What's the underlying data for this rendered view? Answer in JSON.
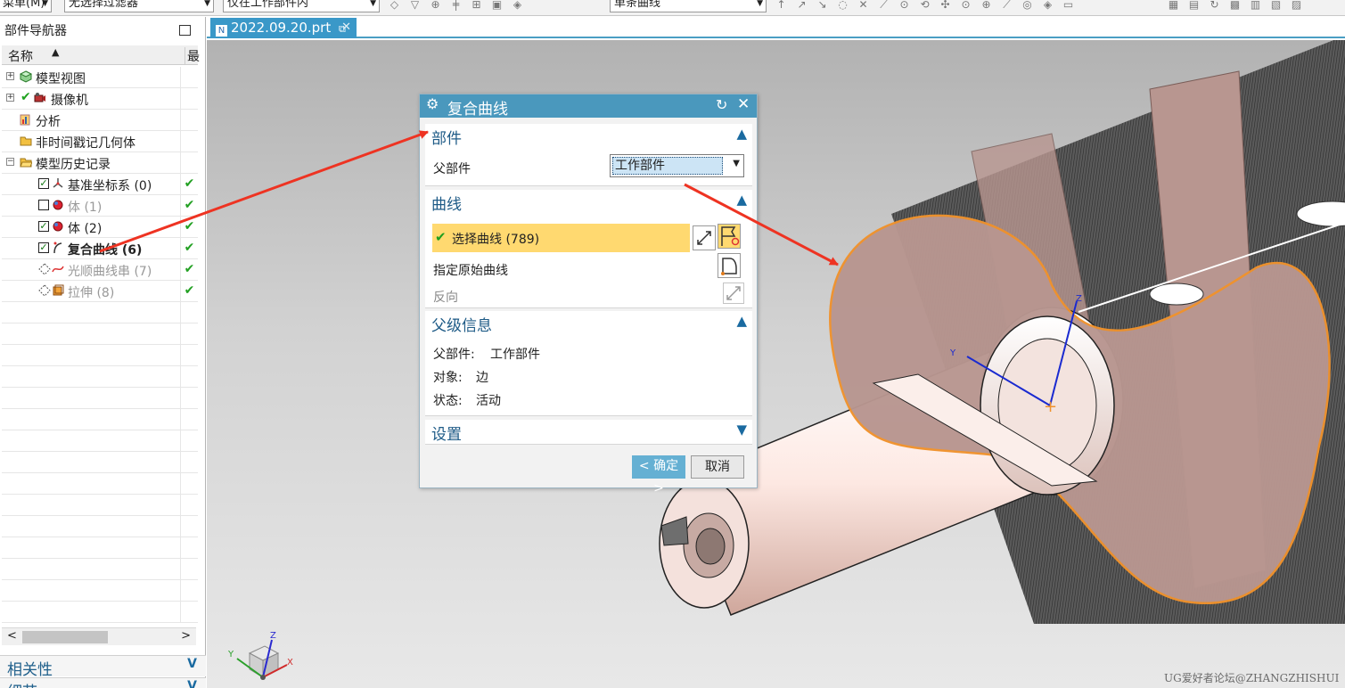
{
  "toolbar": {
    "menu_label": "菜单(M)",
    "filter_label": "无选择过滤器",
    "scope_label": "仅在工作部件内",
    "curve_rule_label": "单条曲线"
  },
  "navigator": {
    "title": "部件导航器",
    "col_name": "名称",
    "col_latest": "最",
    "items": [
      {
        "label": "模型视图",
        "icon": "model-views-icon"
      },
      {
        "label": "摄像机",
        "icon": "camera-icon"
      },
      {
        "label": "分析",
        "icon": "analysis-icon"
      },
      {
        "label": "非时间戳记几何体",
        "icon": "folder-icon"
      },
      {
        "label": "模型历史记录",
        "icon": "folder-open-icon"
      },
      {
        "label": "基准坐标系 (0)",
        "icon": "datum-csys-icon",
        "checked": true
      },
      {
        "label": "体 (1)",
        "icon": "body-icon",
        "checked": false
      },
      {
        "label": "体 (2)",
        "icon": "body-icon",
        "checked": true
      },
      {
        "label": "复合曲线 (6)",
        "icon": "composite-curve-icon",
        "checked": true
      },
      {
        "label": "光顺曲线串 (7)",
        "icon": "smooth-curve-icon"
      },
      {
        "label": "拉伸 (8)",
        "icon": "extrude-icon"
      }
    ],
    "sections": [
      "相关性",
      "细节"
    ]
  },
  "tab": {
    "label": "2022.09.20.prt"
  },
  "dialog": {
    "title": "复合曲线",
    "part": {
      "header": "部件",
      "parent_label": "父部件",
      "parent_value": "工作部件"
    },
    "curve": {
      "header": "曲线",
      "select_label": "选择曲线 (789)",
      "origin_label": "指定原始曲线",
      "reverse_label": "反向"
    },
    "parent_info": {
      "header": "父级信息",
      "parent_label": "父部件:",
      "parent_value": "工作部件",
      "object_label": "对象:",
      "object_value": "边",
      "state_label": "状态:",
      "state_value": "活动"
    },
    "settings": {
      "header": "设置"
    },
    "ok": "< 确定 >",
    "cancel": "取消"
  },
  "triad": {
    "x": "X",
    "y": "Y",
    "z": "Z"
  },
  "watermark": "UG爱好者论坛@ZHANGZHISHUI",
  "colors": {
    "accent": "#4a98bd",
    "selection": "#ffd970",
    "highlight_edge": "#f0922c",
    "arrow": "#ee3322",
    "face": "#b89690"
  }
}
